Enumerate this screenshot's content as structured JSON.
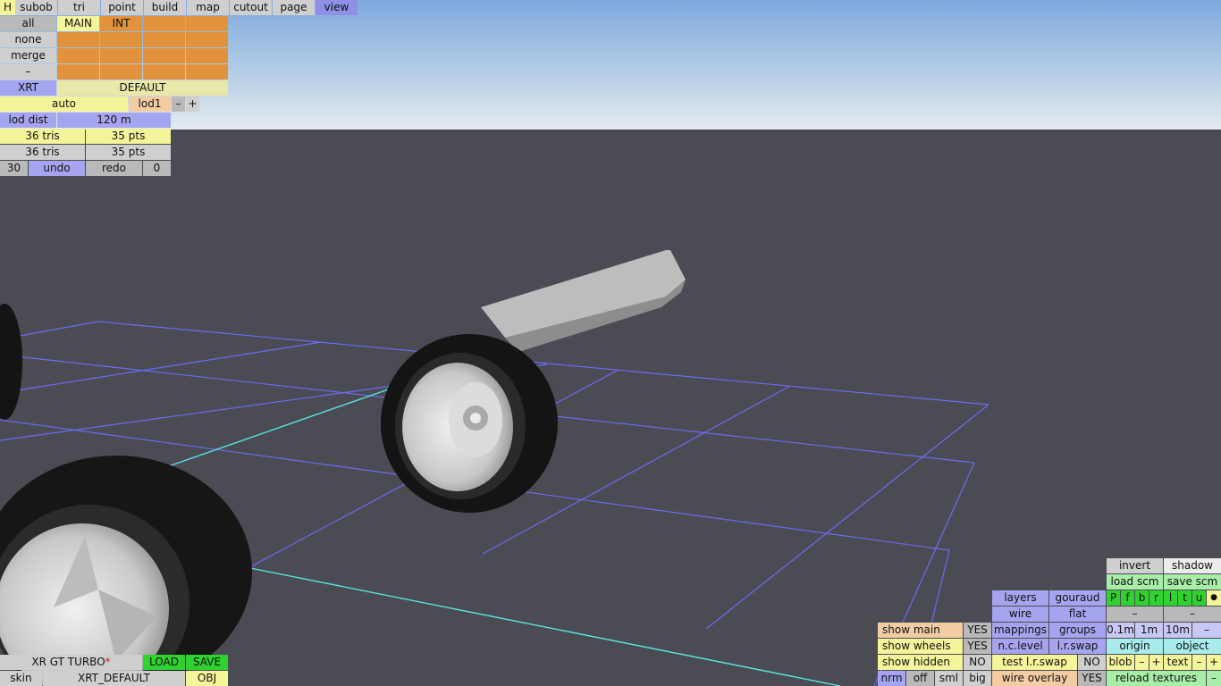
{
  "colors": {
    "orange": "#e3923c",
    "blue": "#a5a5ef",
    "green": "#2fd22f",
    "yellow": "#f4f49a",
    "grid_line": "#6c6cf2",
    "grid_axis": "#59e3e3"
  },
  "top_menu": {
    "h": "H",
    "items": [
      "subob",
      "tri",
      "point",
      "build",
      "map",
      "cutout",
      "page",
      "view"
    ]
  },
  "subob_panel": {
    "row_labels": [
      "all",
      "none",
      "merge",
      "–"
    ],
    "cols": [
      "MAIN",
      "INT"
    ],
    "xrt": "XRT",
    "default": "DEFAULT",
    "auto": "auto",
    "lod": "lod1",
    "minus": "–",
    "plus": "+",
    "lod_dist_label": "lod dist",
    "lod_dist_value": "120 m",
    "tris1": "36 tris",
    "pts1": "35 pts",
    "tris2": "36 tris",
    "pts2": "35 pts",
    "undo_count": "30",
    "undo": "undo",
    "redo": "redo",
    "redo_count": "0"
  },
  "bottom_left": {
    "car": "XR GT TURBO",
    "star": "*",
    "load": "LOAD",
    "save": "SAVE",
    "skin": "skin",
    "skin_name": "XRT_DEFAULT",
    "obj": "OBJ"
  },
  "bottom_right": {
    "invert": "invert",
    "shadow": "shadow",
    "load_scm": "load scm",
    "save_scm": "save scm",
    "layers": "layers",
    "gouraud": "gouraud",
    "views": [
      "P",
      "f",
      "b",
      "r",
      "l",
      "t",
      "u"
    ],
    "dot": "●",
    "wire": "wire",
    "flat": "flat",
    "dash": "–",
    "mappings": "mappings",
    "groups": "groups",
    "scales": [
      "0.1m",
      "1m",
      "10m"
    ],
    "nclevel": "n.c.level",
    "lrswap": "l.r.swap",
    "origin": "origin",
    "object": "object",
    "show_main": "show main",
    "show_main_v": "YES",
    "show_wheels": "show wheels",
    "show_wheels_v": "YES",
    "show_hidden": "show hidden",
    "show_hidden_v": "NO",
    "test_lrswap": "test l.r.swap",
    "test_lrswap_v": "NO",
    "blob": "blob",
    "text": "text",
    "minus": "–",
    "plus": "+",
    "nrm": "nrm",
    "off": "off",
    "sml": "sml",
    "big": "big",
    "wire_overlay": "wire overlay",
    "wire_overlay_v": "YES",
    "reload": "reload textures",
    "reload_minus": "–"
  }
}
